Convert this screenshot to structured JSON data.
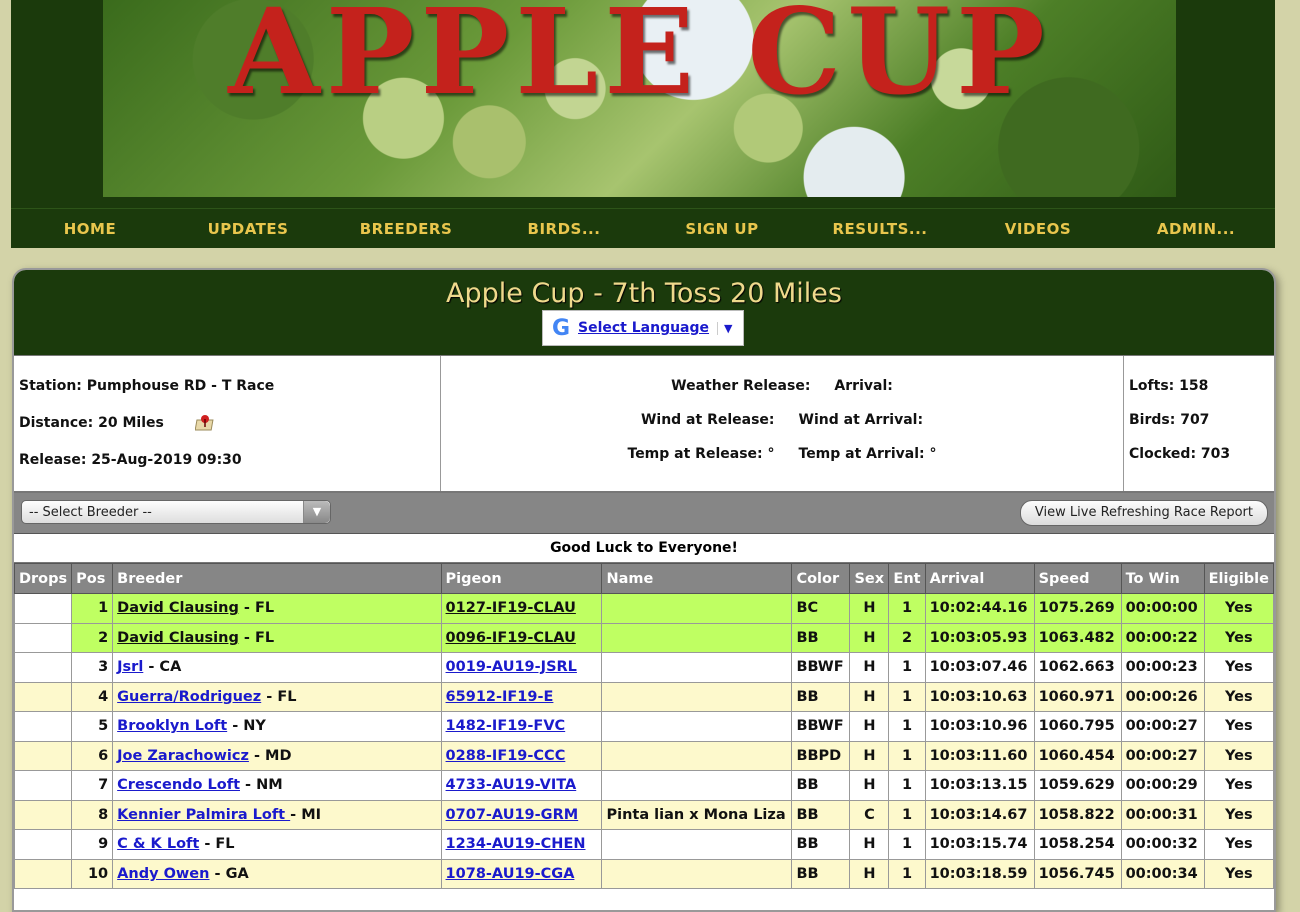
{
  "site": {
    "banner_title": "APPLE CUP"
  },
  "nav": [
    {
      "label": "HOME"
    },
    {
      "label": "UPDATES"
    },
    {
      "label": "BREEDERS"
    },
    {
      "label": "BIRDS..."
    },
    {
      "label": "SIGN UP"
    },
    {
      "label": "RESULTS..."
    },
    {
      "label": "VIDEOS"
    },
    {
      "label": "ADMIN..."
    }
  ],
  "race": {
    "title": "Apple Cup - 7th Toss 20 Miles",
    "translate_label": "Select Language",
    "translate_logo": "G",
    "station": "Station: Pumphouse RD - T Race",
    "distance": "Distance: 20 Miles",
    "release": "Release: 25-Aug-2019 09:30",
    "weather_release": "Weather Release:",
    "arrival": "Arrival:",
    "wind_release": "Wind at Release:",
    "wind_arrival": "Wind at Arrival:",
    "temp_release": "Temp at Release: °",
    "temp_arrival": "Temp at Arrival: °",
    "lofts": "Lofts: 158",
    "birds": "Birds: 707",
    "clocked": "Clocked: 703"
  },
  "toolbar": {
    "breeder_select": "-- Select Breeder --",
    "live_report": "View Live Refreshing Race Report"
  },
  "good_luck": "Good Luck to Everyone!",
  "table": {
    "headers": [
      "Drops",
      "Pos",
      "Breeder",
      "Pigeon",
      "Name",
      "Color",
      "Sex",
      "Ent",
      "Arrival",
      "Speed",
      "To Win",
      "Eligible"
    ],
    "rows": [
      {
        "pos": "1",
        "breeder": "David Clausing",
        "state": " - FL",
        "pigeon": "0127-IF19-CLAU",
        "name": "",
        "color": "BC",
        "sex": "H",
        "ent": "1",
        "arrival": "10:02:44.16",
        "speed": "1075.269",
        "towin": "00:00:00",
        "eligible": "Yes",
        "style": "green"
      },
      {
        "pos": "2",
        "breeder": "David Clausing",
        "state": " - FL",
        "pigeon": "0096-IF19-CLAU",
        "name": "",
        "color": "BB",
        "sex": "H",
        "ent": "2",
        "arrival": "10:03:05.93",
        "speed": "1063.482",
        "towin": "00:00:22",
        "eligible": "Yes",
        "style": "green"
      },
      {
        "pos": "3",
        "breeder": "Jsrl",
        "state": " - CA",
        "pigeon": "0019-AU19-JSRL",
        "name": "",
        "color": "BBWF",
        "sex": "H",
        "ent": "1",
        "arrival": "10:03:07.46",
        "speed": "1062.663",
        "towin": "00:00:23",
        "eligible": "Yes",
        "style": "white"
      },
      {
        "pos": "4",
        "breeder": "Guerra/Rodriguez",
        "state": " - FL",
        "pigeon": "65912-IF19-E",
        "name": "",
        "color": "BB",
        "sex": "H",
        "ent": "1",
        "arrival": "10:03:10.63",
        "speed": "1060.971",
        "towin": "00:00:26",
        "eligible": "Yes",
        "style": "cream"
      },
      {
        "pos": "5",
        "breeder": "Brooklyn Loft",
        "state": " - NY",
        "pigeon": "1482-IF19-FVC",
        "name": "",
        "color": "BBWF",
        "sex": "H",
        "ent": "1",
        "arrival": "10:03:10.96",
        "speed": "1060.795",
        "towin": "00:00:27",
        "eligible": "Yes",
        "style": "white"
      },
      {
        "pos": "6",
        "breeder": "Joe Zarachowicz",
        "state": " - MD",
        "pigeon": "0288-IF19-CCC",
        "name": "",
        "color": "BBPD",
        "sex": "H",
        "ent": "1",
        "arrival": "10:03:11.60",
        "speed": "1060.454",
        "towin": "00:00:27",
        "eligible": "Yes",
        "style": "cream"
      },
      {
        "pos": "7",
        "breeder": "Crescendo Loft",
        "state": " - NM",
        "pigeon": "4733-AU19-VITA",
        "name": "",
        "color": "BB",
        "sex": "H",
        "ent": "1",
        "arrival": "10:03:13.15",
        "speed": "1059.629",
        "towin": "00:00:29",
        "eligible": "Yes",
        "style": "white"
      },
      {
        "pos": "8",
        "breeder": "Kennier Palmira Loft ",
        "state": "- MI",
        "pigeon": "0707-AU19-GRM",
        "name": "Pinta lian x Mona Liza",
        "color": "BB",
        "sex": "C",
        "ent": "1",
        "arrival": "10:03:14.67",
        "speed": "1058.822",
        "towin": "00:00:31",
        "eligible": "Yes",
        "style": "cream"
      },
      {
        "pos": "9",
        "breeder": "C & K Loft",
        "state": " - FL",
        "pigeon": "1234-AU19-CHEN",
        "name": "",
        "color": "BB",
        "sex": "H",
        "ent": "1",
        "arrival": "10:03:15.74",
        "speed": "1058.254",
        "towin": "00:00:32",
        "eligible": "Yes",
        "style": "white"
      },
      {
        "pos": "10",
        "breeder": "Andy Owen",
        "state": " - GA",
        "pigeon": "1078-AU19-CGA",
        "name": "",
        "color": "BB",
        "sex": "H",
        "ent": "1",
        "arrival": "10:03:18.59",
        "speed": "1056.745",
        "towin": "00:00:34",
        "eligible": "Yes",
        "style": "cream"
      }
    ]
  },
  "colors": {
    "header_green": "#1b3a0c",
    "nav_gold": "#e9c64d",
    "winner_green": "#bfff62",
    "row_cream": "#fdf9cc",
    "banner_red": "#c4221c"
  },
  "icons": {
    "map": "map-pin-icon",
    "dropdown": "chevron-down-icon"
  }
}
